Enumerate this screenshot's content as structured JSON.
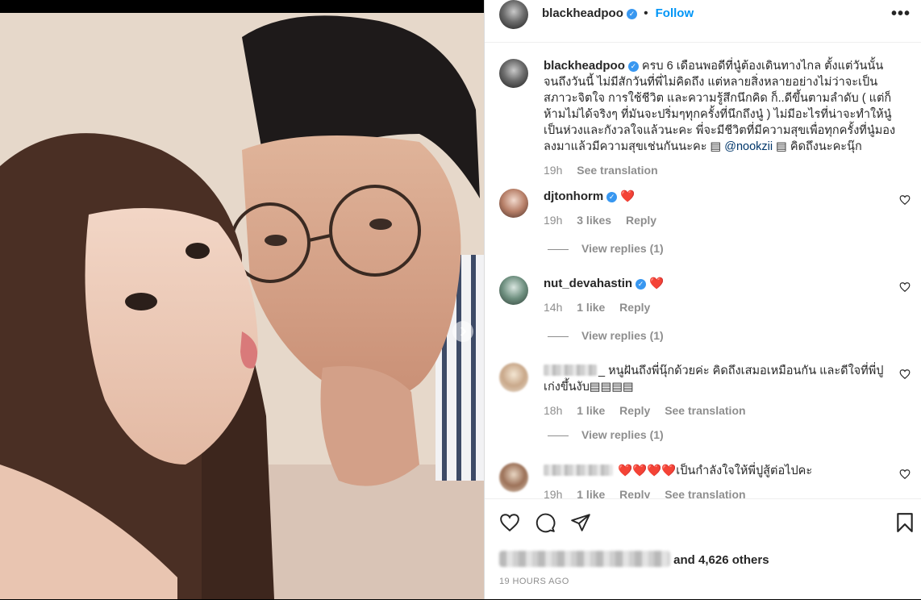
{
  "post": {
    "author": "blackheadpoo",
    "follow_label": "Follow",
    "more_label": "•••",
    "timestamp": "19 HOURS AGO",
    "likes_others": "and 4,626 others"
  },
  "caption": {
    "username": "blackheadpoo",
    "text": "ครบ 6 เดือนพอดีที่นู๋ต้องเดินทางไกล ตั้งแต่วันนั้นจนถึงวันนี้ ไม่มีสักวันที่พี่ไม่คิดถึง แต่หลายสิ่งหลายอย่างไม่ว่าจะเป็นสภาวะจิตใจ การใช้ชีวิต และความรู้สึกนึกคิด ก็..ดีขึ้นตามลำดับ ( แต่ก็ห้ามไม่ได้จริงๆ ที่มันจะปริ่มๆทุกครั้งที่นึกถึงนู๋ ) ไม่มีอะไรที่น่าจะทำให้นู๋เป็นห่วงและกังวลใจแล้วนะคะ พี่จะมีชีวิตที่มีความสุขเพื่อทุกครั้งที่นู๋มองลงมาแล้วมีความสุขเช่นกันนะคะ",
    "emoji_a": "▤",
    "mention": "@nookzii",
    "emoji_b": "▤",
    "tail": "คิดถึงนะคะนุ๊ก",
    "time": "19h",
    "translate": "See translation"
  },
  "comments": [
    {
      "username": "djtonhorm",
      "text": "❤️",
      "time": "19h",
      "likes": "3 likes",
      "reply": "Reply",
      "view_replies": "View replies (1)"
    },
    {
      "username": "nut_devahastin",
      "text": "❤️",
      "time": "14h",
      "likes": "1 like",
      "reply": "Reply",
      "view_replies": "View replies (1)"
    },
    {
      "username_suffix": "_",
      "text": "หนูฝันถึงพี่นุ๊กด้วยค่ะ คิดถึงเสมอเหมือนกัน และดีใจที่พี่ปูเก่งขึ้นงับ▤▤▤▤",
      "time": "18h",
      "likes": "1 like",
      "reply": "Reply",
      "translate": "See translation",
      "view_replies": "View replies (1)"
    },
    {
      "text": "❤️❤️❤️❤️เป็นกำลังใจให้พี่ปูสู้ต่อไปคะ",
      "time": "19h",
      "likes": "1 like",
      "reply": "Reply",
      "translate": "See translation"
    }
  ],
  "colors": {
    "accent": "#0095f6",
    "verified": "#3897f0",
    "heart": "#ed1c24",
    "muted": "#8e8e8e"
  },
  "icons": [
    "heart-icon",
    "comment-icon",
    "share-icon",
    "save-icon",
    "verified-icon",
    "chevron-right-icon"
  ]
}
